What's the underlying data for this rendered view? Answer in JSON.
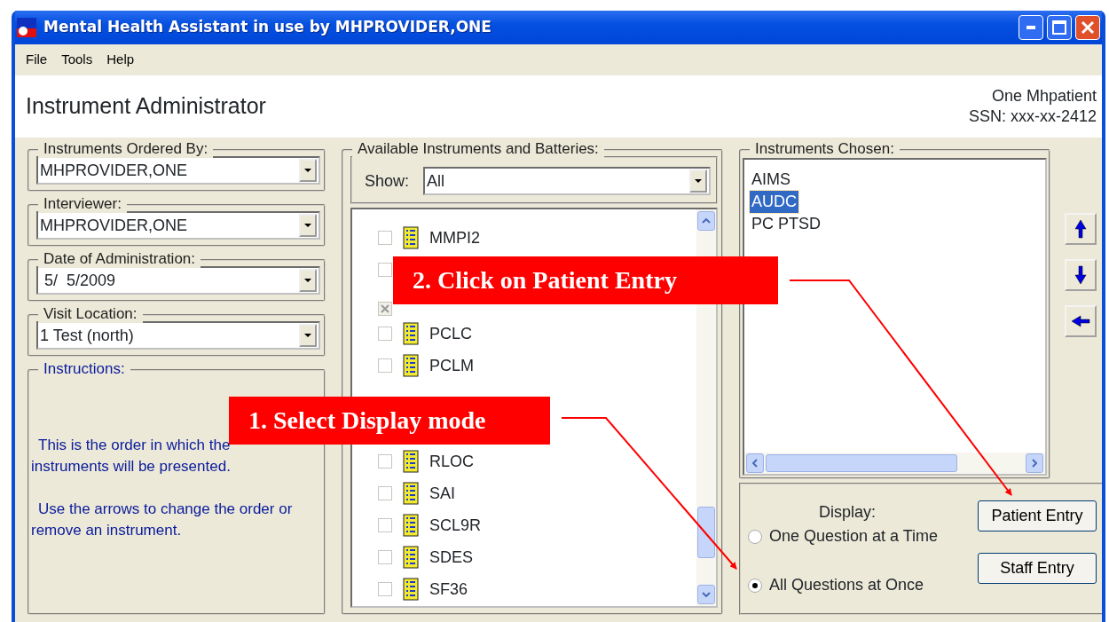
{
  "window": {
    "title": "Mental Health Assistant in use by MHPROVIDER,ONE"
  },
  "menu": [
    "File",
    "Tools",
    "Help"
  ],
  "header": {
    "title": "Instrument Administrator",
    "patient": "One Mhpatient",
    "ssn": "SSN: xxx-xx-2412"
  },
  "fields": [
    {
      "label": "Instruments Ordered By:",
      "value": "MHPROVIDER,ONE"
    },
    {
      "label": "Interviewer:",
      "value": "MHPROVIDER,ONE"
    },
    {
      "label": "Date of Administration:",
      "value": " 5/  5/2009"
    },
    {
      "label": "Visit Location:",
      "value": "1 Test (north)"
    }
  ],
  "instructions": {
    "label": "Instructions:",
    "paragraphs": [
      "This is the order in which the instruments will be presented.",
      "Use the arrows to change the order or remove an instrument."
    ]
  },
  "available": {
    "label": "Available Instruments and Batteries:",
    "show_label": "Show:",
    "show_value": "All",
    "items": [
      {
        "kind": "row",
        "label": "MMPI2",
        "checked": false
      },
      {
        "kind": "checkbox",
        "checked": false
      },
      {
        "kind": "checkbox",
        "checked": true
      },
      {
        "kind": "row",
        "label": "PCLC",
        "checked": false
      },
      {
        "kind": "row",
        "label": "PCLM",
        "checked": false
      },
      {
        "kind": "covered"
      },
      {
        "kind": "covered"
      },
      {
        "kind": "row",
        "label": "RLOC",
        "checked": false
      },
      {
        "kind": "row",
        "label": "SAI",
        "checked": false
      },
      {
        "kind": "row",
        "label": "SCL9R",
        "checked": false
      },
      {
        "kind": "row",
        "label": "SDES",
        "checked": false
      },
      {
        "kind": "row",
        "label": "SF36",
        "checked": false
      }
    ]
  },
  "chosen": {
    "label": "Instruments Chosen:",
    "items": [
      {
        "label": "AIMS",
        "selected": false
      },
      {
        "label": "AUDC",
        "selected": true
      },
      {
        "label": "PC PTSD",
        "selected": false
      }
    ]
  },
  "display": {
    "label": "Display:",
    "options": [
      {
        "label": "One Question at a Time",
        "selected": false
      },
      {
        "label": "All Questions at Once",
        "selected": true
      }
    ]
  },
  "buttons": [
    "Patient Entry",
    "Staff Entry"
  ],
  "callouts": [
    {
      "text": "2. Click on Patient Entry"
    },
    {
      "text": "1. Select Display mode"
    }
  ]
}
